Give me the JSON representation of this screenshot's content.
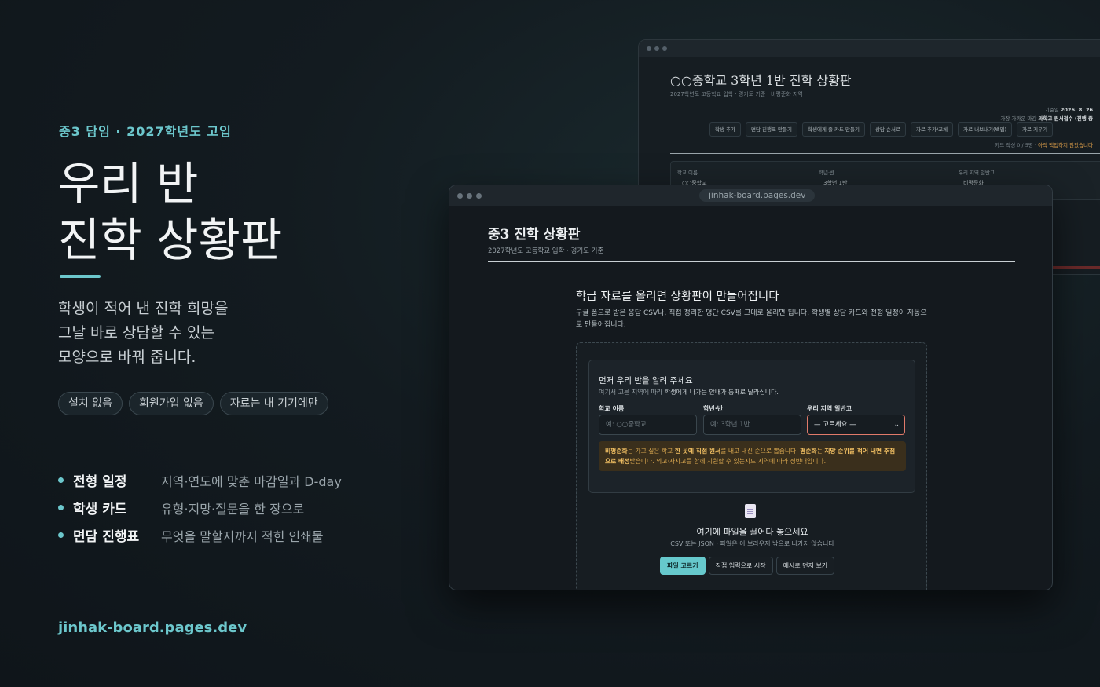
{
  "hero": {
    "eyebrow": "중3 담임 · 2027학년도 고입",
    "title_lines": [
      "우리 반",
      "진학 상황판"
    ],
    "lead_lines": [
      "학생이 적어 낸 진학 희망을",
      "그날 바로 상담할 수 있는",
      "모양으로 바꿔 줍니다."
    ],
    "chips": [
      "설치 없음",
      "회원가입 없음",
      "자료는 내 기기에만"
    ],
    "features": [
      {
        "name": "전형 일정",
        "desc": "지역·연도에 맞춘 마감일과 D-day"
      },
      {
        "name": "학생 카드",
        "desc": "유형·지망·질문을 한 장으로"
      },
      {
        "name": "면담 진행표",
        "desc": "무엇을 말할지까지 적힌 인쇄물"
      }
    ],
    "url": "jinhak-board.pages.dev",
    "accent_color": "#6cc7cc"
  },
  "back_window": {
    "title": "○○중학교 3학년 1반 진학 상황판",
    "subtitle": "2027학년도 고등학교 입학 · 경기도 기준 · 비평준화 지역",
    "date_label": "기준일",
    "date_value": "2026. 8. 26",
    "deadline_label": "가장 가까운 마감",
    "deadline_value": "과학고 원서접수 (진행 중",
    "toolbar": [
      "학생 추가",
      "면담 진행표 만들기",
      "학생에게 줄 카드 만들기",
      "상담 순서로",
      "자료 추가/교체",
      "자료 내보내기(백업)",
      "자료 지우기"
    ],
    "note_prefix": "카드 작성 0 / 5명 ·",
    "note_warn": "아직 백업하지 않았습니다",
    "form_labels": [
      "학교 이름",
      "학년·반",
      "우리 지역 일반고"
    ],
    "form_values": [
      "○○중학교",
      "3학년 1반",
      "비평준화"
    ]
  },
  "window": {
    "address": "jinhak-board.pages.dev",
    "app_title": "중3 진학 상황판",
    "app_subtitle": "2027학년도 고등학교 입학 · 경기도 기준",
    "upload_title": "학급 자료를 올리면 상황판이 만들어집니다",
    "upload_desc": "구글 폼으로 받은 응답 CSV나, 직접 정리한 명단 CSV를 그대로 올리면 됩니다. 학생별 상담 카드와 전형 일정이 자동으로 만들어집니다.",
    "card": {
      "title": "먼저 우리 반을 알려 주세요",
      "sub_prefix": "여기서 고른 지역에 따라",
      "sub_bold": "학생에게 나가는 안내가 통째로 달라집니다.",
      "fields": [
        {
          "label": "학교 이름",
          "placeholder": "예: ○○중학교"
        },
        {
          "label": "학년·반",
          "placeholder": "예: 3학년 1반"
        },
        {
          "label": "우리 지역 일반고",
          "value": "— 고르세요 —"
        }
      ],
      "notice_b1": "비평준화",
      "notice_t1": "는 가고 싶은 학교",
      "notice_b2": "한 곳에 직접 원서",
      "notice_t2": "를 내고 내신 순으로 뽑습니다.",
      "notice_b3": "평준화",
      "notice_t3": "는",
      "notice_b4": "지망 순위를 적어 내면 추첨으로 배정",
      "notice_t4": "받습니다. 외고·자사고를 함께 지원할 수 있는지도 지역에 따라 정반대입니다."
    },
    "drop_icon": "file-icon",
    "drop_title": "여기에 파일을 끌어다 놓으세요",
    "drop_sub": "CSV 또는 JSON · 파일은 이 브라우저 밖으로 나가지 않습니다",
    "buttons": [
      "파일 고르기",
      "직접 입력으로 시작",
      "예시로 먼저 보기"
    ]
  }
}
